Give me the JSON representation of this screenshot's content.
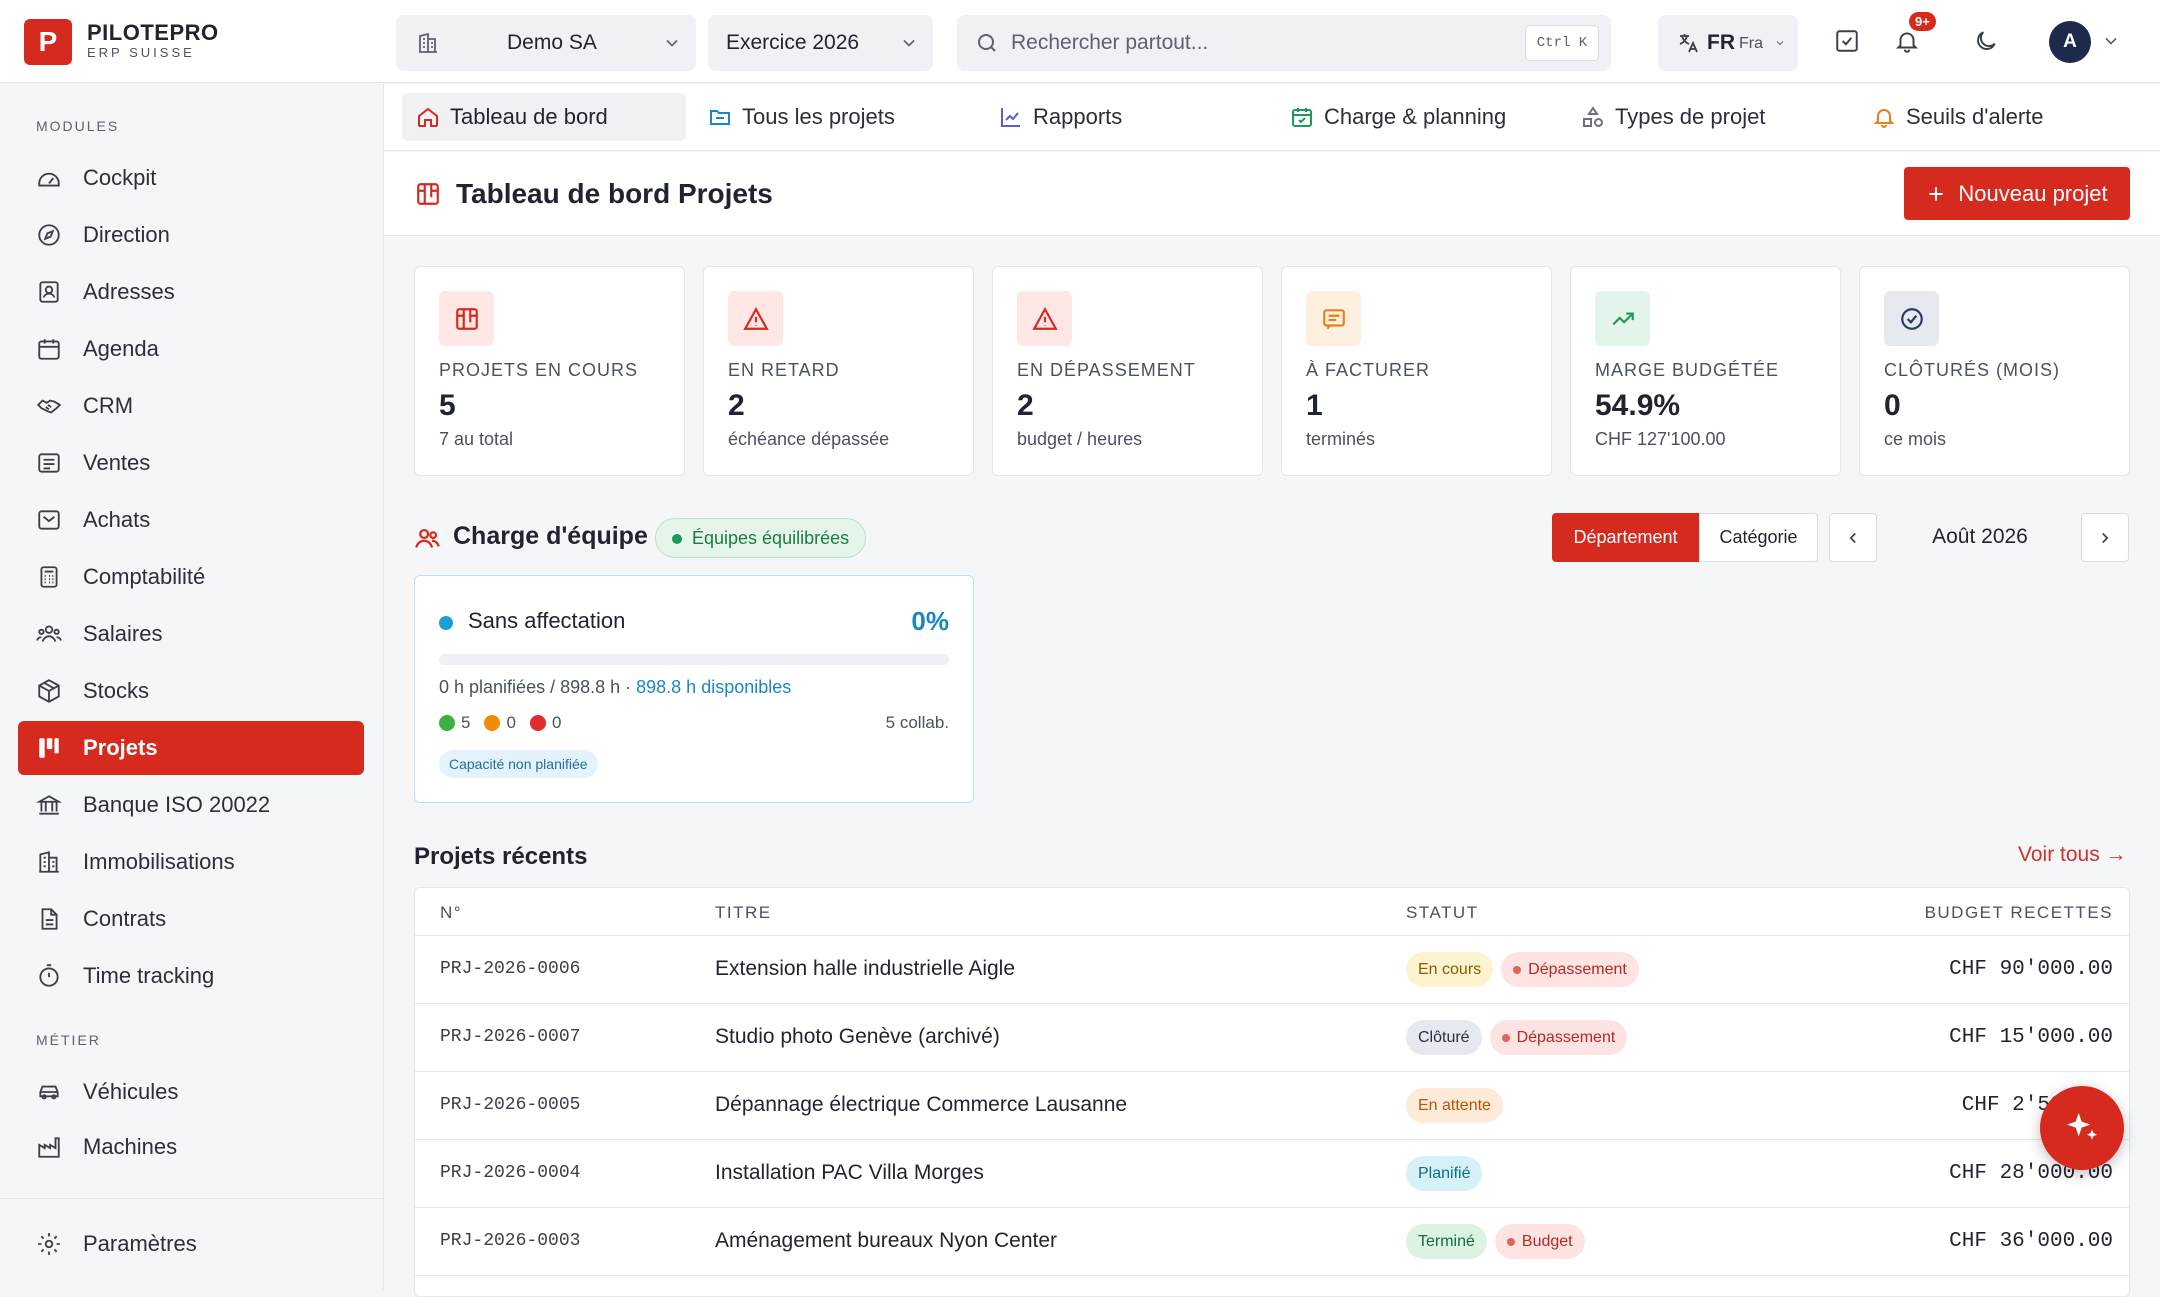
{
  "brand": {
    "logo_letter": "P",
    "name": "PILOTEPRO",
    "subtitle": "ERP SUISSE",
    "accent": "#d72a1f"
  },
  "topbar": {
    "company": "Demo SA",
    "exercise": "Exercice 2026",
    "search_placeholder": "Rechercher partout...",
    "search_shortcut": "Ctrl K",
    "lang_code": "FR",
    "lang_name": "Fra",
    "notif_count": "9+",
    "avatar_initial": "A"
  },
  "sidebar": {
    "modules_label": "MODULES",
    "metier_label": "MÉTIER",
    "items": [
      {
        "label": "Cockpit",
        "icon": "gauge-icon"
      },
      {
        "label": "Direction",
        "icon": "compass-icon"
      },
      {
        "label": "Adresses",
        "icon": "contact-book-icon"
      },
      {
        "label": "Agenda",
        "icon": "calendar-icon"
      },
      {
        "label": "CRM",
        "icon": "handshake-icon"
      },
      {
        "label": "Ventes",
        "icon": "receipt-icon"
      },
      {
        "label": "Achats",
        "icon": "inbox-icon"
      },
      {
        "label": "Comptabilité",
        "icon": "calculator-icon"
      },
      {
        "label": "Salaires",
        "icon": "users-icon"
      },
      {
        "label": "Stocks",
        "icon": "package-icon"
      },
      {
        "label": "Projets",
        "icon": "kanban-icon",
        "active": true
      },
      {
        "label": "Banque ISO 20022",
        "icon": "bank-icon"
      },
      {
        "label": "Immobilisations",
        "icon": "building-icon"
      },
      {
        "label": "Contrats",
        "icon": "document-icon"
      },
      {
        "label": "Time tracking",
        "icon": "timer-icon"
      }
    ],
    "metier_items": [
      {
        "label": "Véhicules",
        "icon": "car-icon"
      },
      {
        "label": "Machines",
        "icon": "factory-icon"
      }
    ],
    "settings": "Paramètres"
  },
  "tabs": [
    {
      "label": "Tableau de bord",
      "icon": "home-icon",
      "active": true
    },
    {
      "label": "Tous les projets",
      "icon": "folder-icon"
    },
    {
      "label": "Rapports",
      "icon": "line-chart-icon"
    },
    {
      "label": "Charge & planning",
      "icon": "calendar-check-icon"
    },
    {
      "label": "Types de projet",
      "icon": "shapes-icon"
    },
    {
      "label": "Seuils d'alerte",
      "icon": "bell-icon"
    }
  ],
  "page": {
    "title": "Tableau de bord Projets",
    "new_button": "Nouveau projet"
  },
  "kpis": [
    {
      "label": "PROJETS EN COURS",
      "value": "5",
      "sub": "7 au total",
      "icon": "kanban-icon",
      "color": "#d72a1f",
      "bg": "#fde8e6"
    },
    {
      "label": "EN RETARD",
      "value": "2",
      "sub": "échéance dépassée",
      "icon": "warning-icon",
      "color": "#d72a1f",
      "bg": "#fde8e6"
    },
    {
      "label": "EN DÉPASSEMENT",
      "value": "2",
      "sub": "budget / heures",
      "icon": "warning-icon",
      "color": "#d72a1f",
      "bg": "#fde8e6"
    },
    {
      "label": "À FACTURER",
      "value": "1",
      "sub": "terminés",
      "icon": "invoice-icon",
      "color": "#e0831a",
      "bg": "#fdf0e0"
    },
    {
      "label": "MARGE BUDGÉTÉE",
      "value": "54.9%",
      "sub": "CHF 127'100.00",
      "icon": "trending-up-icon",
      "color": "#1c9a5a",
      "bg": "#e3f5ea"
    },
    {
      "label": "CLÔTURÉS (MOIS)",
      "value": "0",
      "sub": "ce mois",
      "icon": "check-circle-icon",
      "color": "#2a3a5e",
      "bg": "#e6e9ef"
    }
  ],
  "team": {
    "title": "Charge d'équipe",
    "status": "Équipes équilibrées",
    "seg_active": "Département",
    "seg_other": "Catégorie",
    "month": "Août 2026",
    "card": {
      "name": "Sans affectation",
      "percent": "0%",
      "load_fraction": 0,
      "hours_planned": "0 h planifiées / 898.8 h · ",
      "hours_available": "898.8 h disponibles",
      "green": "5",
      "orange": "0",
      "red": "0",
      "collab": "5 collab.",
      "capacity_tag": "Capacité non planifiée"
    }
  },
  "recent": {
    "title": "Projets récents",
    "see_all": "Voir tous →",
    "columns": [
      "N°",
      "TITRE",
      "STATUT",
      "BUDGET RECETTES"
    ],
    "rows": [
      {
        "num": "PRJ-2026-0006",
        "title": "Extension halle industrielle Aigle",
        "tags": [
          {
            "text": "En cours",
            "kind": "yellow"
          },
          {
            "text": "Dépassement",
            "kind": "red"
          }
        ],
        "budget": "CHF 90'000.00"
      },
      {
        "num": "PRJ-2026-0007",
        "title": "Studio photo Genève (archivé)",
        "tags": [
          {
            "text": "Clôturé",
            "kind": "grey"
          },
          {
            "text": "Dépassement",
            "kind": "red"
          }
        ],
        "budget": "CHF 15'000.00"
      },
      {
        "num": "PRJ-2026-0005",
        "title": "Dépannage électrique Commerce Lausanne",
        "tags": [
          {
            "text": "En attente",
            "kind": "orange"
          }
        ],
        "budget": "CHF 2'500.00"
      },
      {
        "num": "PRJ-2026-0004",
        "title": "Installation PAC Villa Morges",
        "tags": [
          {
            "text": "Planifié",
            "kind": "cyan"
          }
        ],
        "budget": "CHF 28'000.00"
      },
      {
        "num": "PRJ-2026-0003",
        "title": "Aménagement bureaux Nyon Center",
        "tags": [
          {
            "text": "Terminé",
            "kind": "green"
          },
          {
            "text": "Budget",
            "kind": "red"
          }
        ],
        "budget": "CHF 36'000.00"
      }
    ]
  }
}
